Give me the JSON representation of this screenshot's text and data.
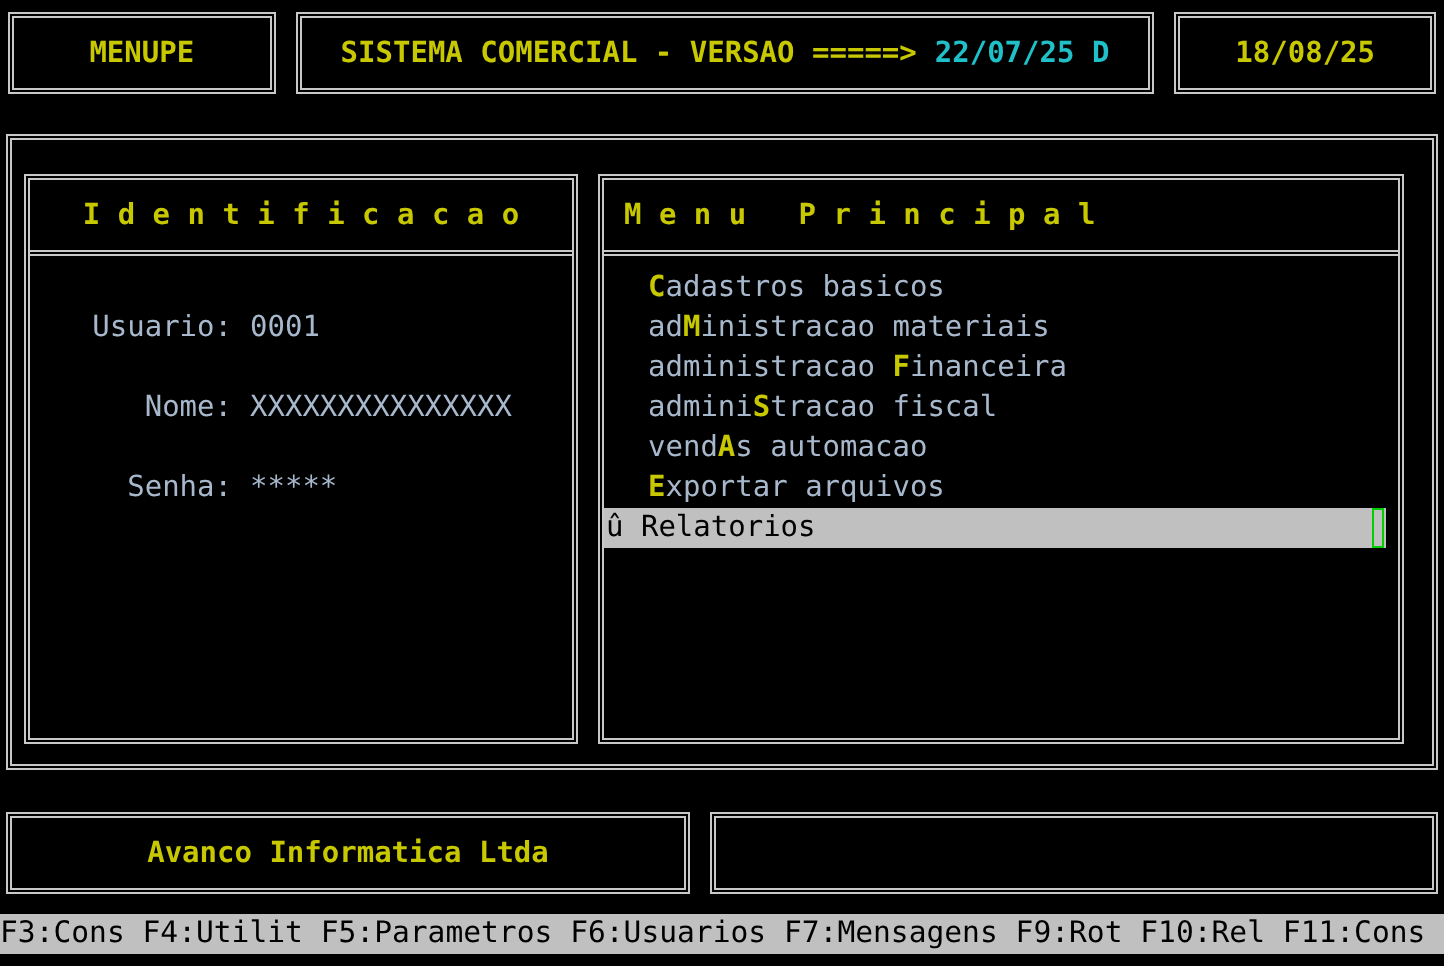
{
  "header": {
    "program": "MENUPE",
    "system_title": "SISTEMA COMERCIAL - VERSAO =====>",
    "version": "22/07/25 D",
    "date": "18/08/25"
  },
  "identification": {
    "title": "I d e n t i f i c a c a o",
    "fields": [
      {
        "label": "Usuario:",
        "value": "0001"
      },
      {
        "label": "Nome:",
        "value": "XXXXXXXXXXXXXXX"
      },
      {
        "label": "Senha:",
        "value": "*****"
      }
    ]
  },
  "menu": {
    "title": "M e n u   P r i n c i p a l",
    "items": [
      {
        "hotkey": "C",
        "after": "adastros basicos",
        "selected": false
      },
      {
        "before": "ad",
        "hotkey": "M",
        "after": "inistracao materiais",
        "selected": false
      },
      {
        "before": "administracao ",
        "hotkey": "F",
        "after": "inanceira",
        "selected": false
      },
      {
        "before": "admini",
        "hotkey": "S",
        "after": "tracao fiscal",
        "selected": false
      },
      {
        "before": "vend",
        "hotkey": "A",
        "after": "s automacao",
        "selected": false
      },
      {
        "hotkey": "E",
        "after": "xportar arquivos",
        "selected": false
      },
      {
        "before": "û Relatorios",
        "selected": true
      }
    ]
  },
  "footer": {
    "company": "Avanco Informatica Ltda"
  },
  "status_bar": "F3:Cons F4:Utilit F5:Parametros F6:Usuarios F7:Mensagens F9:Rot F10:Rel F11:Cons"
}
